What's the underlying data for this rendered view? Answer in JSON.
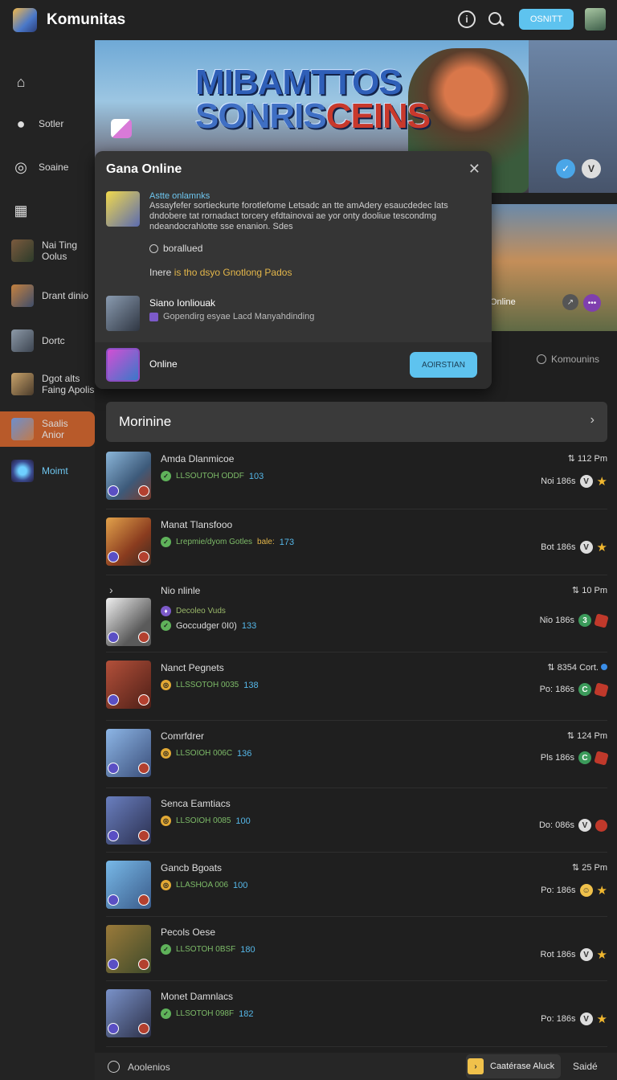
{
  "app": {
    "title": "Komunitas",
    "top_button": "OSNITT",
    "info_icon": "i"
  },
  "sidebar": {
    "items": [
      {
        "label": "",
        "icon": "home-icon"
      },
      {
        "label": "Sotler",
        "icon": "user-icon"
      },
      {
        "label": "Soaine",
        "icon": "chat-icon"
      },
      {
        "label": "",
        "icon": "grid-icon"
      },
      {
        "label": "Nai Ting Oolus"
      },
      {
        "label": "Drant dinio"
      },
      {
        "label": "Dortc"
      },
      {
        "label": "Dgot alts Faing Apolis"
      },
      {
        "label": "Saalis Anior"
      },
      {
        "label": "Moimt"
      }
    ]
  },
  "hero": {
    "title_line1": "MIBAMTTOS",
    "title_line2a": "SONRIS",
    "title_line2b": "CEINS",
    "badge1": "✓",
    "badge2": "V"
  },
  "banner2": {
    "label": "Online"
  },
  "komm_link": "Komounins",
  "popup": {
    "title": "Gana Online",
    "sub": "Astte onlamnks",
    "desc": "Assayfefer sortieckurte forotlefome Letsadc an tte amAdery esaucdedec lats dndobere tat rornadact torcery efdtainovai ae yor onty dooliue tescondmg ndeandocrahlotte sse enanion. Sdes",
    "radio_label": "borallued",
    "note_prefix": "Inere ",
    "note_highlight": "is tho dsyo Gnotlong Pados",
    "row_title": "Siano Ionliouak",
    "row_sub": "Gopendirg esyae Lacd Manyahdinding",
    "foot_label": "Online",
    "foot_button": "AOIRSTIAN"
  },
  "list_header": {
    "title": "Morinine"
  },
  "rows": [
    {
      "name": "Amda Dlanmicoe",
      "tag": "LLSOUTOH ODDF",
      "num": "103",
      "time": "112 Pm",
      "right_text": "Noi 186s",
      "icon": "g",
      "end": "star"
    },
    {
      "name": "Manat Tlansfooo",
      "tag": "Lrepmie/dyom Gotles ",
      "tag2": "bale:",
      "num": "173",
      "time": "",
      "right_text": "Bot 186s",
      "icon": "g",
      "end": "star"
    },
    {
      "name": "Nio nlinle",
      "sub1": "Decoleo Vuds",
      "tag": "Goccudger 0I0)",
      "num": "133",
      "time": "10 Pm",
      "right_text": "Nio 186s",
      "icon": "puzzle",
      "end": "dice",
      "vclass": "green",
      "vtext": "3"
    },
    {
      "name": "Nanct Pegnets",
      "tag": "LLSSOTOH 0035",
      "num": "138",
      "time": "8354 Cort.",
      "right_text": "Po: 186s",
      "icon": "o",
      "end": "dice",
      "vclass": "green",
      "vtext": "C"
    },
    {
      "name": "Comrfdrer",
      "tag": "LLSOIOH 006C",
      "num": "136",
      "time": "124 Pm",
      "right_text": "Pls 186s",
      "icon": "o",
      "end": "dice",
      "vclass": "green",
      "vtext": "C"
    },
    {
      "name": "Senca Eamtiacs",
      "tag": "LLSOIOH 0085",
      "num": "100",
      "time": "",
      "right_text": "Do: 086s",
      "icon": "o",
      "end": "dice2"
    },
    {
      "name": "Gancb Bgoats",
      "tag": "LLASHOA 006",
      "num": "100",
      "time": "25 Pm",
      "right_text": "Po: 186s",
      "icon": "o",
      "end": "star",
      "vclass": "yellow",
      "vtext": "☺"
    },
    {
      "name": "Pecols Oese",
      "tag": "LLSOTOH 0BSF",
      "num": "180",
      "time": "",
      "right_text": "Rot 186s",
      "icon": "g",
      "end": "star"
    },
    {
      "name": "Monet Damnlacs",
      "tag": "LLSOTOH 098F",
      "num": "182",
      "time": "",
      "right_text": "Po: 186s",
      "icon": "g",
      "end": "star"
    }
  ],
  "bottombar": {
    "left_label": "Aoolenios",
    "button_label": "Caatérase Aluck",
    "right_label": "Saidé"
  }
}
